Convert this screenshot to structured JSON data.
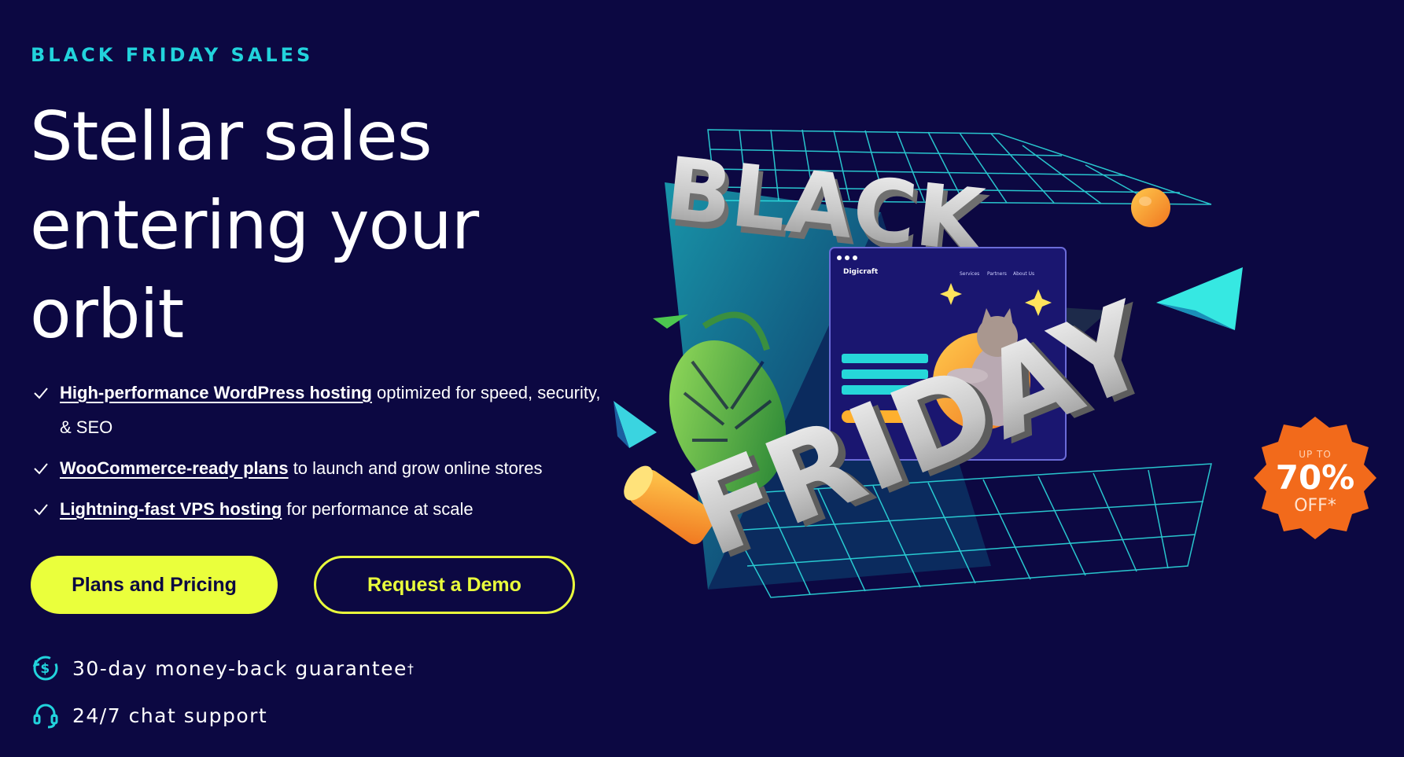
{
  "eyebrow": "BLACK FRIDAY SALES",
  "headline": [
    "Stellar sales",
    "entering your",
    "orbit"
  ],
  "features": [
    {
      "link": "High-performance WordPress hosting",
      "text": " optimized for speed, security, & SEO"
    },
    {
      "link": "WooCommerce-ready plans",
      "text": " to launch and grow online stores"
    },
    {
      "link": "Lightning-fast VPS hosting",
      "text": " for performance at scale"
    }
  ],
  "buttons": {
    "primary": "Plans and Pricing",
    "secondary": "Request a Demo"
  },
  "perks": {
    "guarantee": "30-day money-back guarantee",
    "guarantee_mark": "†",
    "support": "24/7 chat support"
  },
  "hero": {
    "word1": "BLACK",
    "word2": "FRIDAY",
    "mockup_brand": "Digicraft",
    "mockup_nav": [
      "Services",
      "Partners",
      "About Us"
    ],
    "badge": {
      "top": "UP TO",
      "value": "70%",
      "bottom": "OFF*"
    }
  },
  "colors": {
    "background": "#0c0842",
    "accent": "#eaff3c",
    "eyebrow": "#22d3dc",
    "badge": "#f26a1b"
  }
}
